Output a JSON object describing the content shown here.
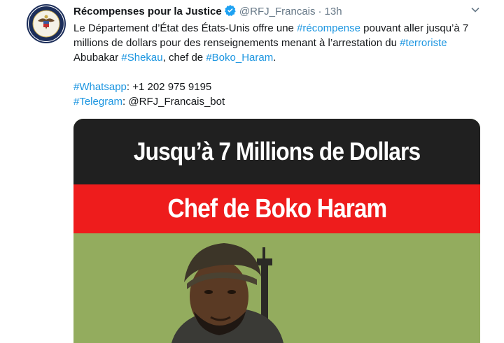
{
  "account": {
    "name": "Récompenses pour la Justice",
    "handle": "@RFJ_Francais",
    "separator": "·",
    "time": "13h"
  },
  "tweet": {
    "line1_before": "Le Département d’État des États-Unis offre une ",
    "tag_recompense": "#récompense",
    "line1_after": " pouvant aller jusqu’à 7 millions de dollars pour des renseignements menant à l’arrestation du ",
    "tag_terroriste": "#terroriste",
    "mid_text": " Abubakar ",
    "tag_shekau": "#Shekau",
    "mid_text2": ", chef de ",
    "tag_boko": "#Boko_Haram",
    "end_text": ".",
    "whatsapp_tag": "#Whatsapp",
    "whatsapp_value": ": +1 202 975 9195",
    "telegram_tag": "#Telegram",
    "telegram_value": ": @RFJ_Francais_bot"
  },
  "media": {
    "banner_top": "Jusqu’à 7 Millions de Dollars",
    "banner_red": "Chef de Boko Haram"
  },
  "colors": {
    "link": "#1b95e0",
    "banner_dark": "#202020",
    "banner_red": "#ee1c1c",
    "photo_green": "#8aa556"
  },
  "icons": {
    "verified": "verified-badge-icon",
    "chevron": "chevron-down-icon",
    "avatar": "state-department-seal"
  }
}
